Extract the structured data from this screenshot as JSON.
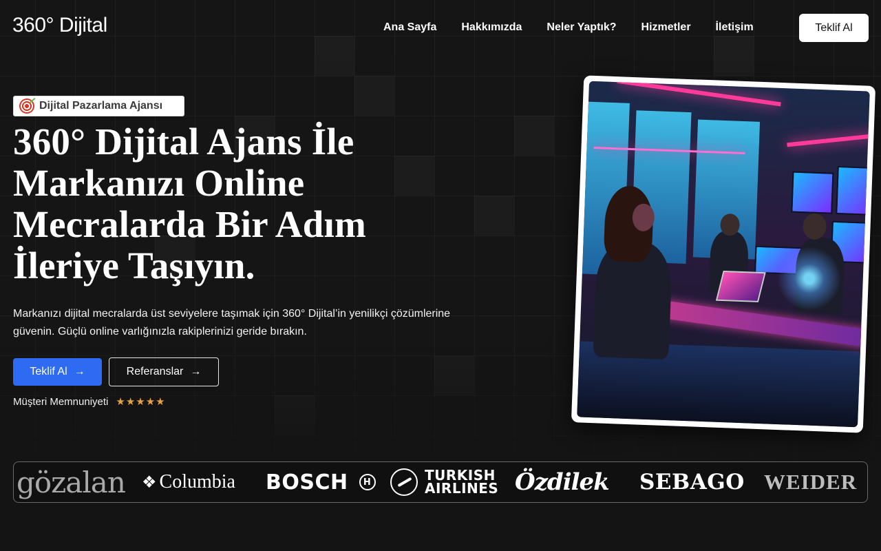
{
  "header": {
    "logo": "360° Dijital",
    "nav": [
      "Ana Sayfa",
      "Hakkımızda",
      "Neler Yaptık?",
      "Hizmetler",
      "İletişim"
    ],
    "cta_label": "Teklif Al"
  },
  "hero": {
    "badge": "Dijital Pazarlama Ajansı",
    "badge_icon": "target-icon",
    "headline_lines": [
      "360° Dijital Ajans İle",
      "Markanızı Online",
      "Mecralarda Bir Adım",
      "İleriye Taşıyın."
    ],
    "description_line1": "Markanızı dijital mecralarda üst seviyelere taşımak için 360° Dijital’in yenilikçi çözümlerine",
    "description_line2": "güvenin. Güçlü online varlığınızla rakiplerinizi geride bırakın.",
    "primary_button": "Teklif Al",
    "secondary_button": "Referanslar",
    "arrow": "→",
    "rating_label": "Müşteri Memnuniyeti",
    "rating_stars": "★★★★★",
    "rating_value": 5,
    "star_color": "#e6a23c",
    "primary_color": "#2e6bf2"
  },
  "brands": {
    "gozalan": "gözalan",
    "columbia": "Columbia",
    "columbia_mark": "❖",
    "bosch": "BOSCH",
    "bosch_mark": "H",
    "turkish_line1": "TURKISH",
    "turkish_line2": "AIRLINES",
    "ozdilek": "Özdilek",
    "sebago": "SEBAGO",
    "weider": "WEIDER"
  }
}
